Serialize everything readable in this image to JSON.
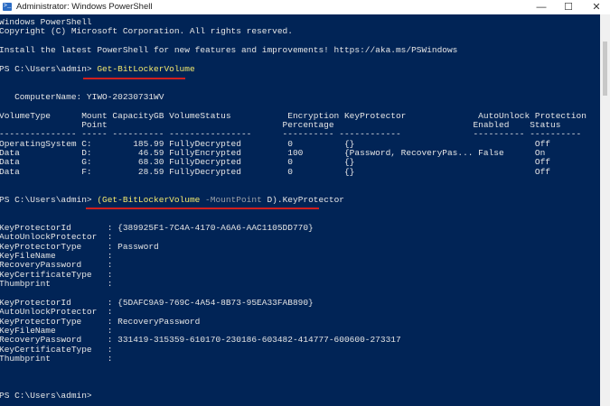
{
  "window": {
    "title": "Administrator: Windows PowerShell",
    "minimize": "—",
    "maximize": "☐",
    "close": "✕"
  },
  "console": {
    "header": [
      "Windows PowerShell",
      "Copyright (C) Microsoft Corporation. All rights reserved.",
      "",
      "Install the latest PowerShell for new features and improvements! https://aka.ms/PSWindows"
    ],
    "prompt": "PS C:\\Users\\admin> ",
    "cmd1": "Get-BitLockerVolume",
    "computer_name": "   ComputerName: YIWO-20230731WV",
    "table_header": [
      "VolumeType      Mount CapacityGB VolumeStatus           Encryption KeyProtector              AutoUnlock Protection",
      "                Point                                  Percentage                           Enabled    Status",
      "--------------- ----- ---------- ----------------      ---------- ------------              ---------- ----------"
    ],
    "table_rows": [
      "OperatingSystem C:        185.99 FullyDecrypted         0          {}                                   Off",
      "Data            D:         46.59 FullyEncrypted         100        {Password, RecoveryPas... False      On",
      "Data            G:         68.30 FullyDecrypted         0          {}                                   Off",
      "Data            F:         28.59 FullyDecrypted         0          {}                                   Off"
    ],
    "cmd2_open": "(Get-BitLockerVolume",
    "cmd2_param": " -MountPoint",
    "cmd2_rest": " D).KeyProtector",
    "protector1": [
      "KeyProtectorId       : {389925F1-7C4A-4170-A6A6-AAC1105DD770}",
      "AutoUnlockProtector  :",
      "KeyProtectorType     : Password",
      "KeyFileName          :",
      "RecoveryPassword     :",
      "KeyCertificateType   :",
      "Thumbprint           :"
    ],
    "protector2": [
      "KeyProtectorId       : {5DAFC9A9-769C-4A54-8B73-95EA33FAB890}",
      "AutoUnlockProtector  :",
      "KeyProtectorType     : RecoveryPassword",
      "KeyFileName          :",
      "RecoveryPassword     : 331419-315359-610170-230186-603482-414777-600600-273317",
      "KeyCertificateType   :",
      "Thumbprint           :"
    ],
    "final_prompt": "PS C:\\Users\\admin>"
  },
  "colors": {
    "background": "#012456",
    "command": "#f2e86d",
    "annotation": "#d0201e"
  }
}
